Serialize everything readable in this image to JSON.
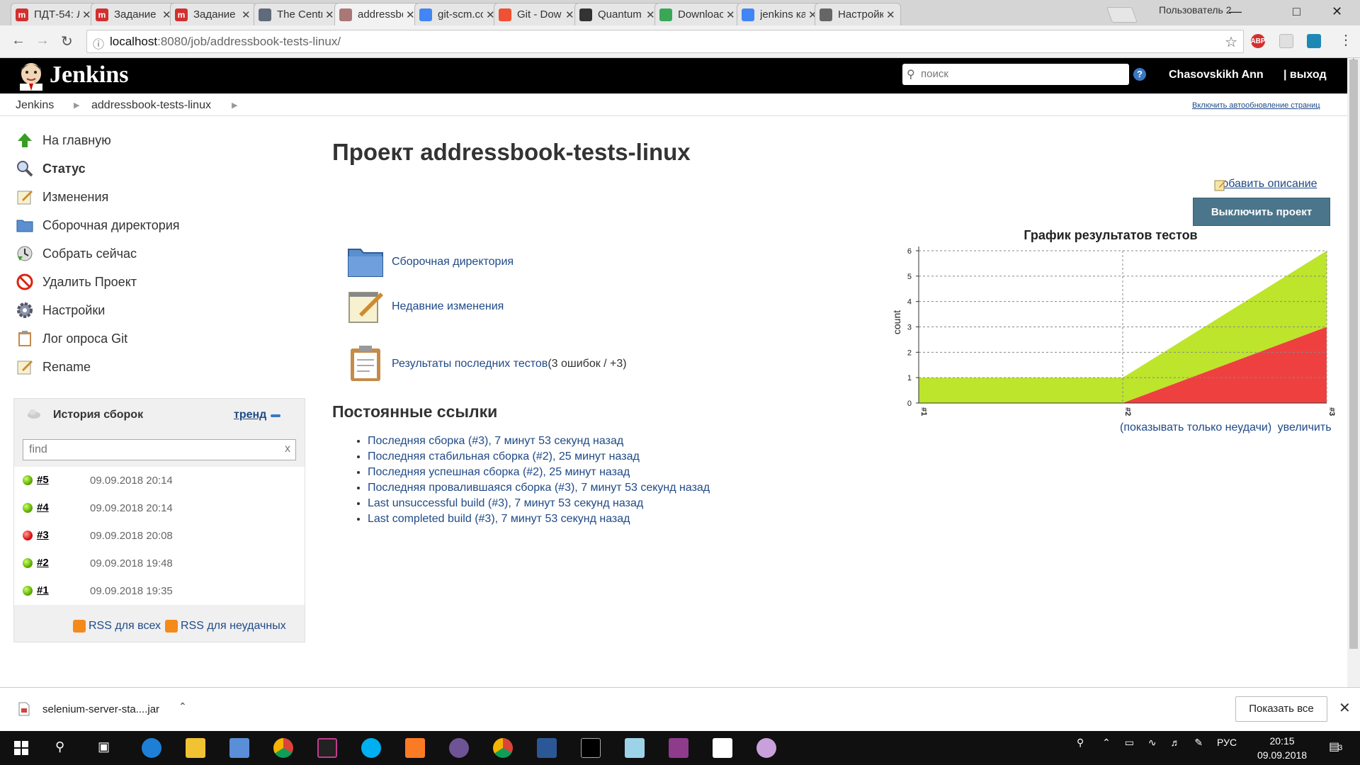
{
  "browser": {
    "tabs": [
      {
        "label": "ПДТ-54: Л",
        "fav": "red-m",
        "color": "#d32f2f"
      },
      {
        "label": "Задание",
        "fav": "red-m",
        "color": "#d32f2f"
      },
      {
        "label": "Задание",
        "fav": "red-m",
        "color": "#d32f2f"
      },
      {
        "label": "The Centr",
        "fav": "doc-icon",
        "color": "#5f6b7a"
      },
      {
        "label": "addressbo",
        "fav": "jenkins-icon",
        "color": "#a77"
      },
      {
        "label": "git-scm.co",
        "fav": "google-icon",
        "color": "#4285f4"
      },
      {
        "label": "Git - Dow",
        "fav": "git-icon",
        "color": "#f05033"
      },
      {
        "label": "Quantum",
        "fav": "quantum-icon",
        "color": "#333"
      },
      {
        "label": "Downloac",
        "fav": "check-icon",
        "color": "#3aa757"
      },
      {
        "label": "jenkins ка",
        "fav": "google-icon",
        "color": "#4285f4"
      },
      {
        "label": "Настройк",
        "fav": "gear-icon",
        "color": "#666"
      }
    ],
    "profile": "Пользователь 2",
    "url_host": "localhost",
    "url_path": ":8080/job/addressbook-tests-linux/"
  },
  "jenkins": {
    "title": "Jenkins",
    "search_placeholder": "поиск",
    "help": "?",
    "user": "Chasovskikh Ann",
    "logout": "| выход",
    "crumbs": [
      "Jenkins",
      "addressbook-tests-linux"
    ],
    "autorefresh": "Включить автообновление страниц"
  },
  "sidebar": {
    "tasks": [
      {
        "label": "На главную",
        "icon": "up-arrow-icon"
      },
      {
        "label": "Статус",
        "icon": "search-icon"
      },
      {
        "label": "Изменения",
        "icon": "notepad-icon"
      },
      {
        "label": "Сборочная директория",
        "icon": "folder-icon"
      },
      {
        "label": "Собрать сейчас",
        "icon": "clock-icon"
      },
      {
        "label": "Удалить Проект",
        "icon": "no-entry-icon"
      },
      {
        "label": "Настройки",
        "icon": "gear-icon"
      },
      {
        "label": "Лог опроса Git",
        "icon": "clipboard-icon"
      },
      {
        "label": "Rename",
        "icon": "notepad-icon"
      }
    ],
    "history": {
      "title": "История сборок",
      "trend": "тренд",
      "find_placeholder": "find",
      "clear": "x",
      "builds": [
        {
          "num": "#5",
          "date": "09.09.2018 20:14",
          "status": "success"
        },
        {
          "num": "#4",
          "date": "09.09.2018 20:14",
          "status": "success"
        },
        {
          "num": "#3",
          "date": "09.09.2018 20:08",
          "status": "failed"
        },
        {
          "num": "#2",
          "date": "09.09.2018 19:48",
          "status": "success"
        },
        {
          "num": "#1",
          "date": "09.09.2018 19:35",
          "status": "success"
        }
      ],
      "rss_all": "RSS для всех",
      "rss_failed": "RSS для неудачных"
    }
  },
  "main": {
    "title": "Проект addressbook-tests-linux",
    "add_description": "добавить описание",
    "disable_button": "Выключить проект",
    "links": [
      {
        "label": "Сборочная директория",
        "icon": "folder-icon",
        "extra": ""
      },
      {
        "label": "Недавние изменения",
        "icon": "notepad-icon",
        "extra": ""
      },
      {
        "label": "Результаты последних тестов",
        "icon": "clipboard-icon",
        "extra": " (3 ошибок / +3)"
      }
    ],
    "permalinks_title": "Постоянные ссылки",
    "permalinks": [
      "Последняя сборка (#3), 7 минут 53 секунд назад",
      "Последняя стабильная сборка (#2), 25 минут назад",
      "Последняя успешная сборка (#2), 25 минут назад",
      "Последняя провалившаяся сборка (#3), 7 минут 53 секунд назад",
      "Last unsuccessful build (#3), 7 минут 53 секунд назад",
      "Last completed build (#3), 7 минут 53 секунд назад"
    ],
    "chart_links": {
      "only_failures": "(показывать только неудачи)",
      "enlarge": "увеличить"
    }
  },
  "chart_data": {
    "type": "area",
    "title": "График результатов тестов",
    "ylabel": "count",
    "xlabel": "",
    "categories": [
      "#1",
      "#2",
      "#3"
    ],
    "series": [
      {
        "name": "failed",
        "color": "#ef4040",
        "values": [
          0,
          0,
          3
        ]
      },
      {
        "name": "passed",
        "color": "#bde52b",
        "values": [
          1,
          1,
          3
        ]
      }
    ],
    "ylim": [
      0,
      6
    ],
    "yticks": [
      0,
      1,
      2,
      3,
      4,
      5,
      6
    ],
    "grid": true
  },
  "downloads": {
    "file": "selenium-server-sta....jar",
    "show_all": "Показать все",
    "close": "✕"
  },
  "taskbar": {
    "lang": "РУС",
    "time": "20:15",
    "date": "09.09.2018",
    "notif": "3"
  }
}
